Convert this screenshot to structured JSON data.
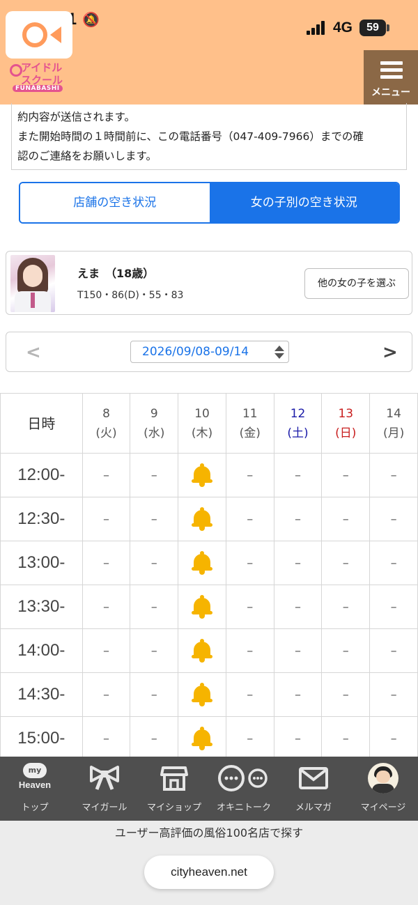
{
  "status_bar": {
    "time": "9:41",
    "network": "4G",
    "battery": "59"
  },
  "header": {
    "logo_text": "アイドルスクール",
    "logo_sub": "FUNABASHI",
    "menu_label": "メニュー",
    "bg_color": "#ffc08a",
    "menu_color": "#8b6846"
  },
  "notice": {
    "line1": "約内容が送信されます。",
    "line2": "また開始時間の１時間前に、この電話番号（047-409-7966）までの確",
    "line3": "認のご連絡をお願いします。"
  },
  "toggle": {
    "store_label": "店舗の空き状況",
    "girl_label": "女の子別の空き状況",
    "active": "girl",
    "accent": "#1a73e8"
  },
  "profile": {
    "name": "えま",
    "age": "（18歳）",
    "measurements": "T150・86(D)・55・83",
    "choose_button": "他の女の子を選ぶ"
  },
  "date_nav": {
    "range": "2026/09/08-09/14"
  },
  "schedule": {
    "corner_label": "日時",
    "days": [
      {
        "num": "8",
        "dow": "(火)",
        "kind": "weekday"
      },
      {
        "num": "9",
        "dow": "(水)",
        "kind": "weekday"
      },
      {
        "num": "10",
        "dow": "(木)",
        "kind": "weekday"
      },
      {
        "num": "11",
        "dow": "(金)",
        "kind": "weekday"
      },
      {
        "num": "12",
        "dow": "(土)",
        "kind": "sat"
      },
      {
        "num": "13",
        "dow": "(日)",
        "kind": "sun"
      },
      {
        "num": "14",
        "dow": "(月)",
        "kind": "weekday"
      }
    ],
    "rows": [
      {
        "time": "12:00-",
        "cells": [
          "–",
          "–",
          "bell",
          "–",
          "–",
          "–",
          "–"
        ]
      },
      {
        "time": "12:30-",
        "cells": [
          "–",
          "–",
          "bell",
          "–",
          "–",
          "–",
          "–"
        ]
      },
      {
        "time": "13:00-",
        "cells": [
          "–",
          "–",
          "bell",
          "–",
          "–",
          "–",
          "–"
        ]
      },
      {
        "time": "13:30-",
        "cells": [
          "–",
          "–",
          "bell",
          "–",
          "–",
          "–",
          "–"
        ]
      },
      {
        "time": "14:00-",
        "cells": [
          "–",
          "–",
          "bell",
          "–",
          "–",
          "–",
          "–"
        ]
      },
      {
        "time": "14:30-",
        "cells": [
          "–",
          "–",
          "bell",
          "–",
          "–",
          "–",
          "–"
        ]
      },
      {
        "time": "15:00-",
        "cells": [
          "–",
          "–",
          "bell",
          "–",
          "–",
          "–",
          "–"
        ]
      }
    ]
  },
  "bottom_nav": {
    "items": [
      {
        "label": "トップ",
        "icon": "myheaven-icon"
      },
      {
        "label": "マイガール",
        "icon": "ribbon-icon"
      },
      {
        "label": "マイショップ",
        "icon": "shop-icon"
      },
      {
        "label": "オキニトーク",
        "icon": "chat-icon"
      },
      {
        "label": "メルマガ",
        "icon": "mail-icon"
      },
      {
        "label": "マイページ",
        "icon": "user-avatar-icon"
      }
    ],
    "myheaven_top": "my",
    "myheaven_word": "Heaven"
  },
  "footer": {
    "promo": "ユーザー高評価の風俗100名店で探す",
    "url": "cityheaven.net"
  }
}
